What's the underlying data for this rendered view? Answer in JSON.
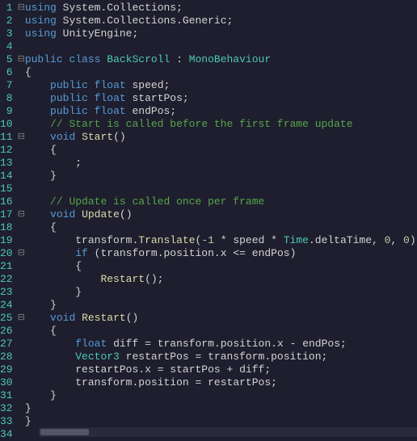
{
  "lines": [
    {
      "n": 1,
      "fold": "-",
      "mod": false,
      "code": [
        [
          "kw",
          "using"
        ],
        [
          "op",
          " "
        ],
        [
          "ns",
          "System"
        ],
        [
          "op",
          "."
        ],
        [
          "ns",
          "Collections"
        ],
        [
          "op",
          ";"
        ]
      ]
    },
    {
      "n": 2,
      "fold": "",
      "mod": false,
      "code": [
        [
          "kw",
          "using"
        ],
        [
          "op",
          " "
        ],
        [
          "ns",
          "System"
        ],
        [
          "op",
          "."
        ],
        [
          "ns",
          "Collections"
        ],
        [
          "op",
          "."
        ],
        [
          "ns",
          "Generic"
        ],
        [
          "op",
          ";"
        ]
      ]
    },
    {
      "n": 3,
      "fold": "",
      "mod": false,
      "code": [
        [
          "kw",
          "using"
        ],
        [
          "op",
          " "
        ],
        [
          "ns",
          "UnityEngine"
        ],
        [
          "op",
          ";"
        ]
      ]
    },
    {
      "n": 4,
      "fold": "",
      "mod": false,
      "code": []
    },
    {
      "n": 5,
      "fold": "-",
      "mod": false,
      "code": [
        [
          "kw",
          "public"
        ],
        [
          "op",
          " "
        ],
        [
          "kw",
          "class"
        ],
        [
          "op",
          " "
        ],
        [
          "type",
          "BackScroll"
        ],
        [
          "op",
          " : "
        ],
        [
          "type",
          "MonoBehaviour"
        ]
      ]
    },
    {
      "n": 6,
      "fold": "",
      "mod": true,
      "code": [
        [
          "op",
          "{"
        ]
      ]
    },
    {
      "n": 7,
      "fold": "",
      "mod": true,
      "code": [
        [
          "op",
          "    "
        ],
        [
          "kw",
          "public"
        ],
        [
          "op",
          " "
        ],
        [
          "kw",
          "float"
        ],
        [
          "op",
          " "
        ],
        [
          "field",
          "speed"
        ],
        [
          "op",
          ";"
        ]
      ]
    },
    {
      "n": 8,
      "fold": "",
      "mod": true,
      "code": [
        [
          "op",
          "    "
        ],
        [
          "kw",
          "public"
        ],
        [
          "op",
          " "
        ],
        [
          "kw",
          "float"
        ],
        [
          "op",
          " "
        ],
        [
          "field",
          "startPos"
        ],
        [
          "op",
          ";"
        ]
      ]
    },
    {
      "n": 9,
      "fold": "",
      "mod": true,
      "code": [
        [
          "op",
          "    "
        ],
        [
          "kw",
          "public"
        ],
        [
          "op",
          " "
        ],
        [
          "kw",
          "float"
        ],
        [
          "op",
          " "
        ],
        [
          "field",
          "endPos"
        ],
        [
          "op",
          ";"
        ]
      ]
    },
    {
      "n": 10,
      "fold": "",
      "mod": false,
      "code": [
        [
          "op",
          "    "
        ],
        [
          "comment",
          "// Start is called before the first frame update"
        ]
      ]
    },
    {
      "n": 11,
      "fold": "-",
      "mod": false,
      "code": [
        [
          "op",
          "    "
        ],
        [
          "kw",
          "void"
        ],
        [
          "op",
          " "
        ],
        [
          "method",
          "Start"
        ],
        [
          "op",
          "()"
        ]
      ]
    },
    {
      "n": 12,
      "fold": "",
      "mod": false,
      "code": [
        [
          "op",
          "    {"
        ]
      ]
    },
    {
      "n": 13,
      "fold": "",
      "mod": false,
      "code": [
        [
          "op",
          "        ;"
        ]
      ]
    },
    {
      "n": 14,
      "fold": "",
      "mod": false,
      "code": [
        [
          "op",
          "    }"
        ]
      ]
    },
    {
      "n": 15,
      "fold": "",
      "mod": false,
      "code": []
    },
    {
      "n": 16,
      "fold": "",
      "mod": false,
      "code": [
        [
          "op",
          "    "
        ],
        [
          "comment",
          "// Update is called once per frame"
        ]
      ]
    },
    {
      "n": 17,
      "fold": "-",
      "mod": false,
      "code": [
        [
          "op",
          "    "
        ],
        [
          "kw",
          "void"
        ],
        [
          "op",
          " "
        ],
        [
          "method",
          "Update"
        ],
        [
          "op",
          "()"
        ]
      ]
    },
    {
      "n": 18,
      "fold": "",
      "mod": false,
      "code": [
        [
          "op",
          "    {"
        ]
      ]
    },
    {
      "n": 19,
      "fold": "",
      "mod": true,
      "code": [
        [
          "op",
          "        "
        ],
        [
          "ident",
          "transform"
        ],
        [
          "op",
          "."
        ],
        [
          "method",
          "Translate"
        ],
        [
          "op",
          "("
        ],
        [
          "num",
          "-1"
        ],
        [
          "op",
          " * "
        ],
        [
          "field",
          "speed"
        ],
        [
          "op",
          " * "
        ],
        [
          "type",
          "Time"
        ],
        [
          "op",
          "."
        ],
        [
          "field",
          "deltaTime"
        ],
        [
          "op",
          ", "
        ],
        [
          "num",
          "0"
        ],
        [
          "op",
          ", "
        ],
        [
          "num",
          "0"
        ],
        [
          "op",
          ");"
        ]
      ]
    },
    {
      "n": 20,
      "fold": "-",
      "mod": true,
      "code": [
        [
          "op",
          "        "
        ],
        [
          "kw",
          "if"
        ],
        [
          "op",
          " ("
        ],
        [
          "ident",
          "transform"
        ],
        [
          "op",
          "."
        ],
        [
          "field",
          "position"
        ],
        [
          "op",
          "."
        ],
        [
          "field",
          "x"
        ],
        [
          "op",
          " <= "
        ],
        [
          "field",
          "endPos"
        ],
        [
          "op",
          ")"
        ]
      ]
    },
    {
      "n": 21,
      "fold": "",
      "mod": true,
      "code": [
        [
          "op",
          "        {"
        ]
      ]
    },
    {
      "n": 22,
      "fold": "",
      "mod": true,
      "code": [
        [
          "op",
          "            "
        ],
        [
          "method",
          "Restart"
        ],
        [
          "op",
          "();"
        ]
      ]
    },
    {
      "n": 23,
      "fold": "",
      "mod": true,
      "code": [
        [
          "op",
          "        }"
        ]
      ]
    },
    {
      "n": 24,
      "fold": "",
      "mod": true,
      "code": [
        [
          "op",
          "    }"
        ]
      ]
    },
    {
      "n": 25,
      "fold": "-",
      "mod": true,
      "code": [
        [
          "op",
          "    "
        ],
        [
          "kw",
          "void"
        ],
        [
          "op",
          " "
        ],
        [
          "method",
          "Restart"
        ],
        [
          "op",
          "()"
        ]
      ]
    },
    {
      "n": 26,
      "fold": "",
      "mod": true,
      "code": [
        [
          "op",
          "    {"
        ]
      ]
    },
    {
      "n": 27,
      "fold": "",
      "mod": true,
      "code": [
        [
          "op",
          "        "
        ],
        [
          "kw",
          "float"
        ],
        [
          "op",
          " "
        ],
        [
          "ident",
          "diff"
        ],
        [
          "op",
          " = "
        ],
        [
          "ident",
          "transform"
        ],
        [
          "op",
          "."
        ],
        [
          "field",
          "position"
        ],
        [
          "op",
          "."
        ],
        [
          "field",
          "x"
        ],
        [
          "op",
          " - "
        ],
        [
          "field",
          "endPos"
        ],
        [
          "op",
          ";"
        ]
      ]
    },
    {
      "n": 28,
      "fold": "",
      "mod": true,
      "code": [
        [
          "op",
          "        "
        ],
        [
          "type",
          "Vector3"
        ],
        [
          "op",
          " "
        ],
        [
          "ident",
          "restartPos"
        ],
        [
          "op",
          " = "
        ],
        [
          "ident",
          "transform"
        ],
        [
          "op",
          "."
        ],
        [
          "field",
          "position"
        ],
        [
          "op",
          ";"
        ]
      ]
    },
    {
      "n": 29,
      "fold": "",
      "mod": true,
      "code": [
        [
          "op",
          "        "
        ],
        [
          "ident",
          "restartPos"
        ],
        [
          "op",
          "."
        ],
        [
          "field",
          "x"
        ],
        [
          "op",
          " = "
        ],
        [
          "field",
          "startPos"
        ],
        [
          "op",
          " + "
        ],
        [
          "ident",
          "diff"
        ],
        [
          "op",
          ";"
        ]
      ]
    },
    {
      "n": 30,
      "fold": "",
      "mod": true,
      "code": [
        [
          "op",
          "        "
        ],
        [
          "ident",
          "transform"
        ],
        [
          "op",
          "."
        ],
        [
          "field",
          "position"
        ],
        [
          "op",
          " = "
        ],
        [
          "ident",
          "restartPos"
        ],
        [
          "op",
          ";"
        ]
      ]
    },
    {
      "n": 31,
      "fold": "",
      "mod": true,
      "code": [
        [
          "op",
          "    }"
        ]
      ]
    },
    {
      "n": 32,
      "fold": "",
      "mod": true,
      "code": [
        [
          "op",
          "}"
        ]
      ]
    },
    {
      "n": 33,
      "fold": "",
      "mod": false,
      "code": [
        [
          "op",
          "}"
        ]
      ]
    },
    {
      "n": 34,
      "fold": "",
      "mod": false,
      "code": []
    }
  ],
  "fold_glyph": "⊟"
}
